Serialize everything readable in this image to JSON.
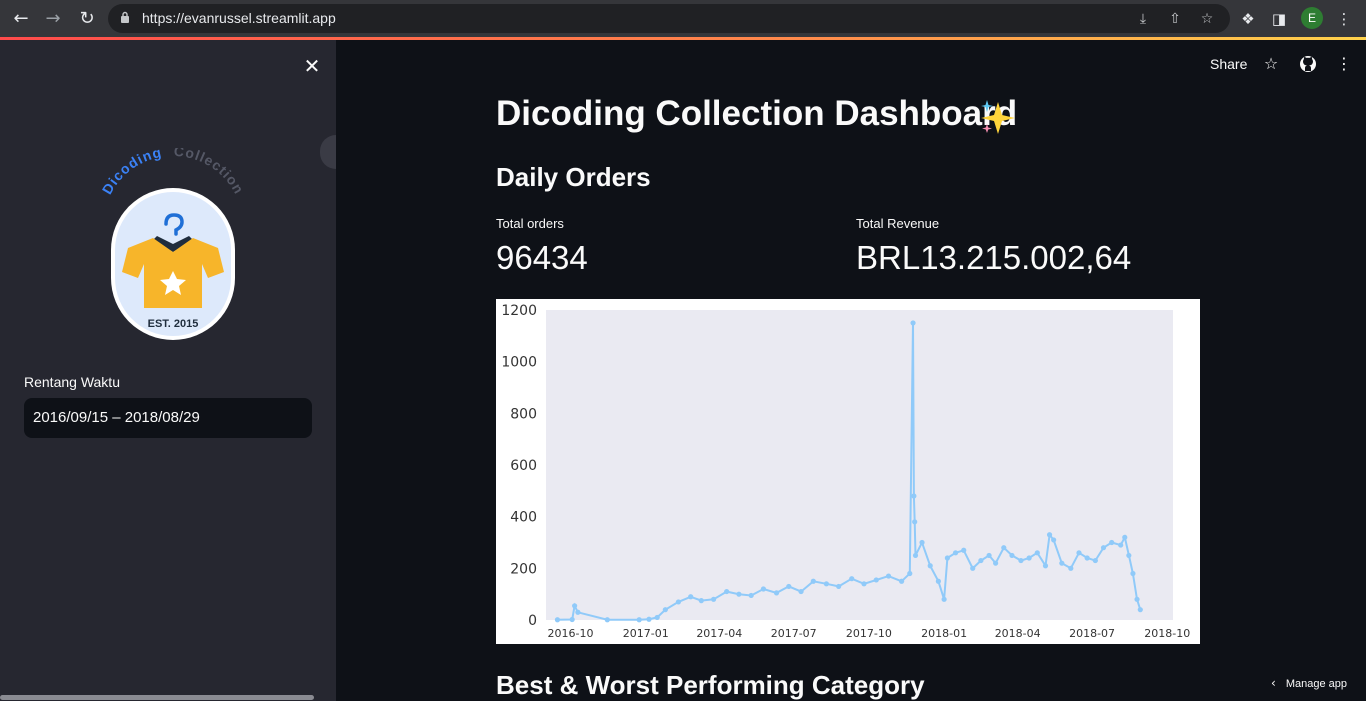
{
  "browser": {
    "url": "https://evanrussel.streamlit.app",
    "back_icon": "back-arrow-icon",
    "forward_icon": "forward-arrow-icon",
    "reload_icon": "reload-icon",
    "profile_initial": "E"
  },
  "sidebar": {
    "logo": {
      "arc_text_1": "Dicoding",
      "arc_text_2": "Collection",
      "est_text": "EST. 2015"
    },
    "date_label": "Rentang Waktu",
    "date_value": "2016/09/15 – 2018/08/29"
  },
  "header": {
    "share_label": "Share"
  },
  "main": {
    "title": "Dicoding Collection Dashboard",
    "section_daily": "Daily Orders",
    "metric_orders_label": "Total orders",
    "metric_orders_value": "96434",
    "metric_revenue_label": "Total Revenue",
    "metric_revenue_value": "BRL13.215.002,64",
    "section_category": "Best & Worst Performing Category",
    "manage_app": "Manage app"
  },
  "colors": {
    "line": "#90CAF9",
    "plot_bg": "#EAEAF2",
    "accent": "#FF4B4B"
  },
  "chart_data": {
    "type": "line",
    "title": "",
    "xlabel": "",
    "ylabel": "",
    "ylim": [
      0,
      1200
    ],
    "yticks": [
      0,
      200,
      400,
      600,
      800,
      1000,
      1200
    ],
    "xticks": [
      "2016-10",
      "2017-01",
      "2017-04",
      "2017-07",
      "2017-10",
      "2018-01",
      "2018-04",
      "2018-07",
      "2018-10"
    ],
    "grid": false,
    "x": [
      "2016-09-15",
      "2016-10-03",
      "2016-10-06",
      "2016-10-10",
      "2016-11-15",
      "2016-12-24",
      "2017-01-05",
      "2017-01-15",
      "2017-01-25",
      "2017-02-10",
      "2017-02-25",
      "2017-03-10",
      "2017-03-25",
      "2017-04-10",
      "2017-04-25",
      "2017-05-10",
      "2017-05-25",
      "2017-06-10",
      "2017-06-25",
      "2017-07-10",
      "2017-07-25",
      "2017-08-10",
      "2017-08-25",
      "2017-09-10",
      "2017-09-25",
      "2017-10-10",
      "2017-10-25",
      "2017-11-10",
      "2017-11-20",
      "2017-11-24",
      "2017-11-25",
      "2017-11-26",
      "2017-11-27",
      "2017-12-05",
      "2017-12-15",
      "2017-12-25",
      "2018-01-01",
      "2018-01-05",
      "2018-01-15",
      "2018-01-25",
      "2018-02-05",
      "2018-02-15",
      "2018-02-25",
      "2018-03-05",
      "2018-03-15",
      "2018-03-25",
      "2018-04-05",
      "2018-04-15",
      "2018-04-25",
      "2018-05-05",
      "2018-05-10",
      "2018-05-15",
      "2018-05-25",
      "2018-06-05",
      "2018-06-15",
      "2018-06-25",
      "2018-07-05",
      "2018-07-15",
      "2018-07-25",
      "2018-08-05",
      "2018-08-10",
      "2018-08-15",
      "2018-08-20",
      "2018-08-25",
      "2018-08-29"
    ],
    "y": [
      1,
      2,
      55,
      30,
      1,
      1,
      3,
      10,
      40,
      70,
      90,
      75,
      80,
      110,
      100,
      95,
      120,
      105,
      130,
      110,
      150,
      140,
      130,
      160,
      140,
      155,
      170,
      150,
      180,
      1150,
      480,
      380,
      250,
      300,
      210,
      150,
      80,
      240,
      260,
      270,
      200,
      230,
      250,
      220,
      280,
      250,
      230,
      240,
      260,
      210,
      330,
      310,
      220,
      200,
      260,
      240,
      230,
      280,
      300,
      290,
      320,
      250,
      180,
      80,
      40
    ]
  }
}
